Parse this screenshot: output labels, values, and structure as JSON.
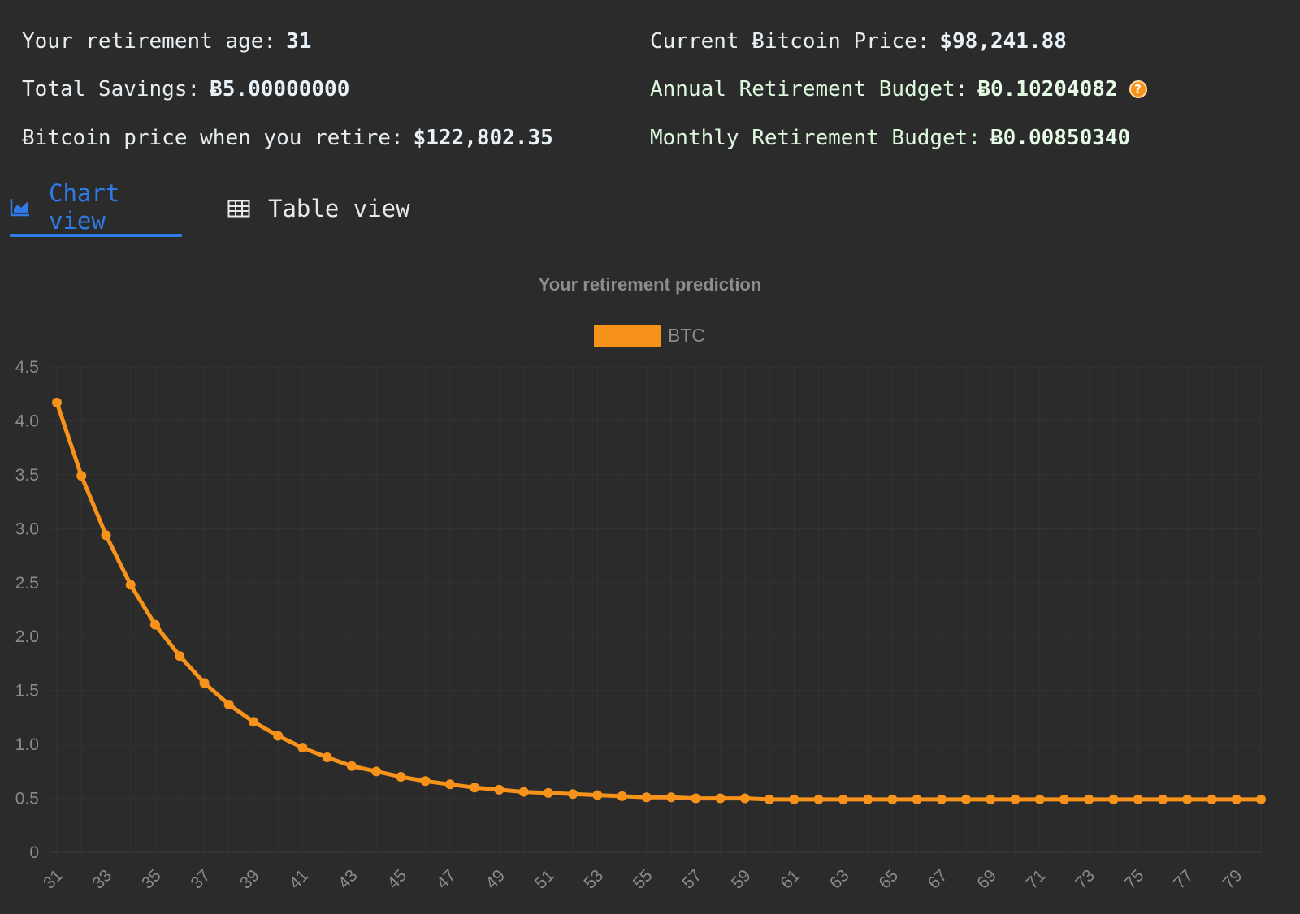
{
  "stats": {
    "age_label": "Your retirement age:",
    "age_value": "31",
    "savings_label": "Total Savings:",
    "savings_value": "Ƀ5.00000000",
    "future_price_label": "Ƀitcoin price when you retire:",
    "future_price_value": "$122,802.35",
    "current_price_label": "Current Ƀitcoin Price:",
    "current_price_value": "$98,241.88",
    "annual_budget_label": "Annual Retirement Budget:",
    "annual_budget_value": "Ƀ0.10204082",
    "help_icon_glyph": "?",
    "monthly_budget_label": "Monthly Retirement Budget:",
    "monthly_budget_value": "Ƀ0.00850340"
  },
  "tabs": {
    "chart_label": "Chart view",
    "chart_icon": "area-chart-icon",
    "table_label": "Table view",
    "table_icon": "table-icon",
    "active": "chart"
  },
  "colors": {
    "background": "#2b2b2b",
    "accent_blue": "#2f7ae5",
    "series_orange": "#f7931a"
  },
  "chart_data": {
    "type": "line",
    "title": "Your retirement prediction",
    "legend": "top-center",
    "grid": true,
    "ylim": [
      0,
      4.5
    ],
    "y_ticks": [
      "0",
      "0.5",
      "1.0",
      "1.5",
      "2.0",
      "2.5",
      "3.0",
      "3.5",
      "4.0",
      "4.5"
    ],
    "x_tick_labels": [
      "31",
      "33",
      "35",
      "37",
      "39",
      "41",
      "43",
      "45",
      "47",
      "49",
      "51",
      "53",
      "55",
      "57",
      "59",
      "61",
      "63",
      "65",
      "67",
      "69",
      "71",
      "73",
      "75",
      "77",
      "79"
    ],
    "x": [
      31,
      32,
      33,
      34,
      35,
      36,
      37,
      38,
      39,
      40,
      41,
      42,
      43,
      44,
      45,
      46,
      47,
      48,
      49,
      50,
      51,
      52,
      53,
      54,
      55,
      56,
      57,
      58,
      59,
      60,
      61,
      62,
      63,
      64,
      65,
      66,
      67,
      68,
      69,
      70,
      71,
      72,
      73,
      74,
      75,
      76,
      77,
      78,
      79,
      80
    ],
    "series": [
      {
        "name": "BTC",
        "color": "#f7931a",
        "values": [
          4.17,
          3.49,
          2.94,
          2.48,
          2.11,
          1.82,
          1.57,
          1.37,
          1.21,
          1.08,
          0.97,
          0.88,
          0.8,
          0.75,
          0.7,
          0.66,
          0.63,
          0.6,
          0.58,
          0.56,
          0.55,
          0.54,
          0.53,
          0.52,
          0.51,
          0.51,
          0.5,
          0.5,
          0.5,
          0.49,
          0.49,
          0.49,
          0.49,
          0.49,
          0.49,
          0.49,
          0.49,
          0.49,
          0.49,
          0.49,
          0.49,
          0.49,
          0.49,
          0.49,
          0.49,
          0.49,
          0.49,
          0.49,
          0.49,
          0.49
        ]
      }
    ]
  }
}
